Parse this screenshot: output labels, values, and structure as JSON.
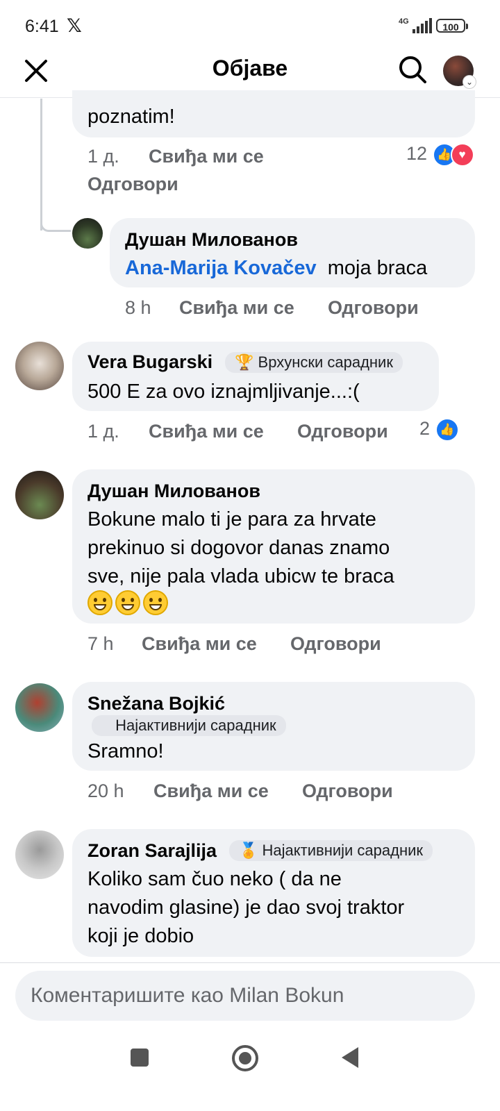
{
  "status_bar": {
    "time": "6:41",
    "network": "4G",
    "battery": "100"
  },
  "header": {
    "title": "Објаве"
  },
  "comments": [
    {
      "text_tail": "poznatim!",
      "time": "1 д.",
      "like": "Свиђа ми се",
      "reply": "Одговори",
      "reactions_count": "12"
    },
    {
      "name": "Душан Милованов",
      "mention": "Ana-Marija Kovačev",
      "text": "moja braca",
      "time": "8 h",
      "like": "Свиђа ми се",
      "reply": "Одговори"
    },
    {
      "name": "Vera Bugarski",
      "badge": "Врхунски сарадник",
      "text": "500 E za ovo iznajmljivanje...:(",
      "time": "1 д.",
      "like": "Свиђа ми се",
      "reply": "Одговори",
      "reactions_count": "2"
    },
    {
      "name": "Душан Милованов",
      "text_lines": [
        "Bokune malo ti je para za hrvate",
        "prekinuo si dogovor danas znamo",
        "sve, nije pala vlada  ubicw te braca"
      ],
      "time": "7 h",
      "like": "Свиђа ми се",
      "reply": "Одговори"
    },
    {
      "name": "Snežana Bojkić",
      "badge": "Најактивнији сарадник",
      "text": "Sramno!",
      "time": "20 h",
      "like": "Свиђа ми се",
      "reply": "Одговори"
    },
    {
      "name": "Zoran Sarajlija",
      "badge": "Најактивнији сарадник",
      "text_lines": [
        "Koliko sam čuo neko ( da ne",
        "navodim glasine) je dao svoj traktor",
        "koji je dobio"
      ]
    }
  ],
  "composer": {
    "placeholder": "Коментаришите као Milan Bokun"
  },
  "icons": [
    "close-icon",
    "search-icon",
    "like-reaction-icon",
    "love-reaction-icon",
    "trophy-icon",
    "badge-icon"
  ]
}
